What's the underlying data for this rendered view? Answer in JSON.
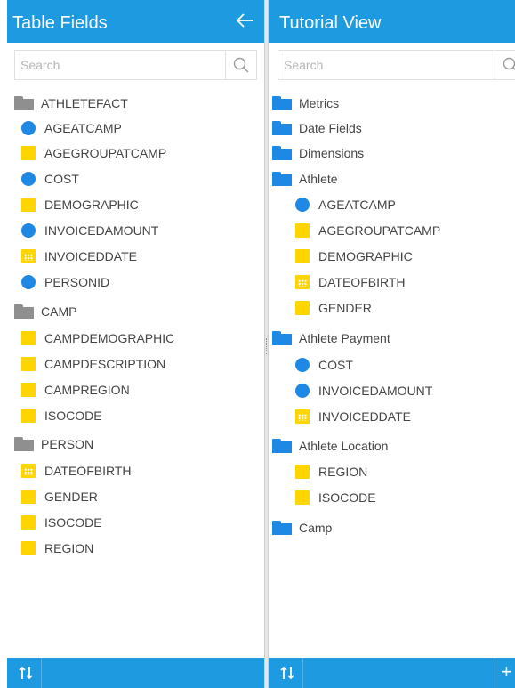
{
  "colors": {
    "header": "#1e9ae0",
    "blue_folder": "#1e88e5",
    "gray_folder": "#8f8f8f",
    "metric_dot": "#1e88e5",
    "dimension_square": "#ffd500"
  },
  "left": {
    "title": "Table Fields",
    "back_icon": "arrow-left-icon",
    "search": {
      "placeholder": "Search",
      "value": ""
    },
    "tree": [
      {
        "kind": "folder",
        "label": "ATHLETEFACT",
        "color": "gray"
      },
      {
        "kind": "metric",
        "label": "AGEATCAMP"
      },
      {
        "kind": "dimension",
        "label": "AGEGROUPATCAMP"
      },
      {
        "kind": "metric",
        "label": "COST"
      },
      {
        "kind": "dimension",
        "label": "DEMOGRAPHIC"
      },
      {
        "kind": "metric",
        "label": "INVOICEDAMOUNT"
      },
      {
        "kind": "date",
        "label": "INVOICEDDATE"
      },
      {
        "kind": "metric",
        "label": "PERSONID"
      },
      {
        "kind": "folder",
        "label": "CAMP",
        "color": "gray"
      },
      {
        "kind": "dimension",
        "label": "CAMPDEMOGRAPHIC"
      },
      {
        "kind": "dimension",
        "label": "CAMPDESCRIPTION"
      },
      {
        "kind": "dimension",
        "label": "CAMPREGION"
      },
      {
        "kind": "dimension",
        "label": "ISOCODE"
      },
      {
        "kind": "folder",
        "label": "PERSON",
        "color": "gray"
      },
      {
        "kind": "date",
        "label": "DATEOFBIRTH"
      },
      {
        "kind": "dimension",
        "label": "GENDER"
      },
      {
        "kind": "dimension",
        "label": "ISOCODE"
      },
      {
        "kind": "dimension",
        "label": "REGION"
      }
    ]
  },
  "right": {
    "title": "Tutorial View",
    "search": {
      "placeholder": "Search",
      "value": ""
    },
    "tree": [
      {
        "kind": "folder",
        "label": "Metrics",
        "color": "blue"
      },
      {
        "kind": "folder",
        "label": "Date Fields",
        "color": "blue"
      },
      {
        "kind": "folder",
        "label": "Dimensions",
        "color": "blue"
      },
      {
        "kind": "folder",
        "label": "Athlete",
        "color": "blue"
      },
      {
        "kind": "metric",
        "label": "AGEATCAMP"
      },
      {
        "kind": "dimension",
        "label": "AGEGROUPATCAMP"
      },
      {
        "kind": "dimension",
        "label": "DEMOGRAPHIC"
      },
      {
        "kind": "date",
        "label": "DATEOFBIRTH"
      },
      {
        "kind": "dimension",
        "label": "GENDER"
      },
      {
        "kind": "folder",
        "label": "Athlete Payment",
        "color": "blue"
      },
      {
        "kind": "metric",
        "label": "COST"
      },
      {
        "kind": "metric",
        "label": "INVOICEDAMOUNT"
      },
      {
        "kind": "date",
        "label": "INVOICEDDATE"
      },
      {
        "kind": "folder",
        "label": "Athlete Location",
        "color": "blue"
      },
      {
        "kind": "dimension",
        "label": "REGION"
      },
      {
        "kind": "dimension",
        "label": "ISOCODE"
      },
      {
        "kind": "folder",
        "label": "Camp",
        "color": "blue"
      }
    ]
  },
  "footer": {
    "sort_icon": "sort-icon",
    "add_label": "+"
  }
}
